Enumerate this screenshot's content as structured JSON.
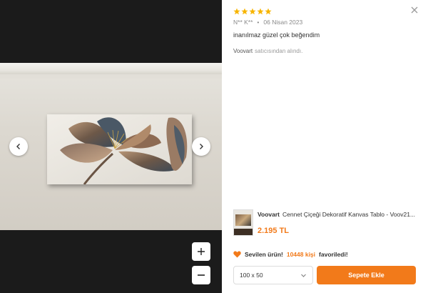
{
  "viewer": {
    "controls": {
      "zoom_in": "+",
      "zoom_out": "−"
    }
  },
  "review": {
    "rating": 5,
    "author": "N** K**",
    "separator": "•",
    "date": "06 Nisan 2023",
    "text": "inanılmaz güzel çok beğendim",
    "seller_name": "Voovart",
    "seller_suffix": "satıcısından alındı."
  },
  "product": {
    "brand": "Voovart",
    "title": "Cennet Çiçeği Dekoratif Kanvas Tablo - Voov21...",
    "price": "2.195 TL"
  },
  "favorite": {
    "prefix": "Sevilen ürün!",
    "count": "10448 kişi",
    "suffix": "favoriledi!"
  },
  "purchase": {
    "size_selected": "100 x 50",
    "add_to_cart": "Sepete Ekle"
  },
  "colors": {
    "accent": "#f27a1a",
    "star": "#f7b500"
  }
}
